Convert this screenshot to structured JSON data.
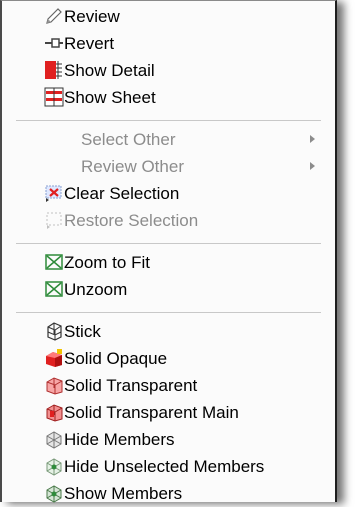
{
  "menu": {
    "items": {
      "review": "Review",
      "revert": "Revert",
      "show_detail": "Show Detail",
      "show_sheet": "Show Sheet",
      "select_other": "Select Other",
      "review_other": "Review Other",
      "clear_selection": "Clear Selection",
      "restore_selection": "Restore Selection",
      "zoom_to_fit": "Zoom to Fit",
      "unzoom": "Unzoom",
      "stick": "Stick",
      "solid_opaque": "Solid Opaque",
      "solid_transparent": "Solid Transparent",
      "solid_transparent_main": "Solid Transparent Main",
      "hide_members": "Hide Members",
      "hide_unselected_members": "Hide Unselected Members",
      "show_members": "Show Members"
    },
    "icons": {
      "review": "pencil-icon",
      "revert": "revert-icon",
      "show_detail": "detail-icon",
      "show_sheet": "sheet-icon",
      "clear_selection": "clear-selection-icon",
      "restore_selection": "restore-selection-icon",
      "zoom_to_fit": "zoom-to-fit-icon",
      "unzoom": "unzoom-icon",
      "stick": "stick-model-icon",
      "solid_opaque": "solid-opaque-icon",
      "solid_transparent": "solid-transparent-icon",
      "solid_transparent_main": "solid-transparent-main-icon",
      "hide_members": "hide-members-icon",
      "hide_unselected_members": "hide-unselected-members-icon",
      "show_members": "show-members-icon"
    },
    "colors": {
      "enabled_text": "#000000",
      "disabled_text": "#8c8c8c",
      "separator": "#c8c8c8",
      "background": "#fbfbfb",
      "accent_red": "#e02020",
      "accent_green": "#2e8b3a"
    }
  }
}
